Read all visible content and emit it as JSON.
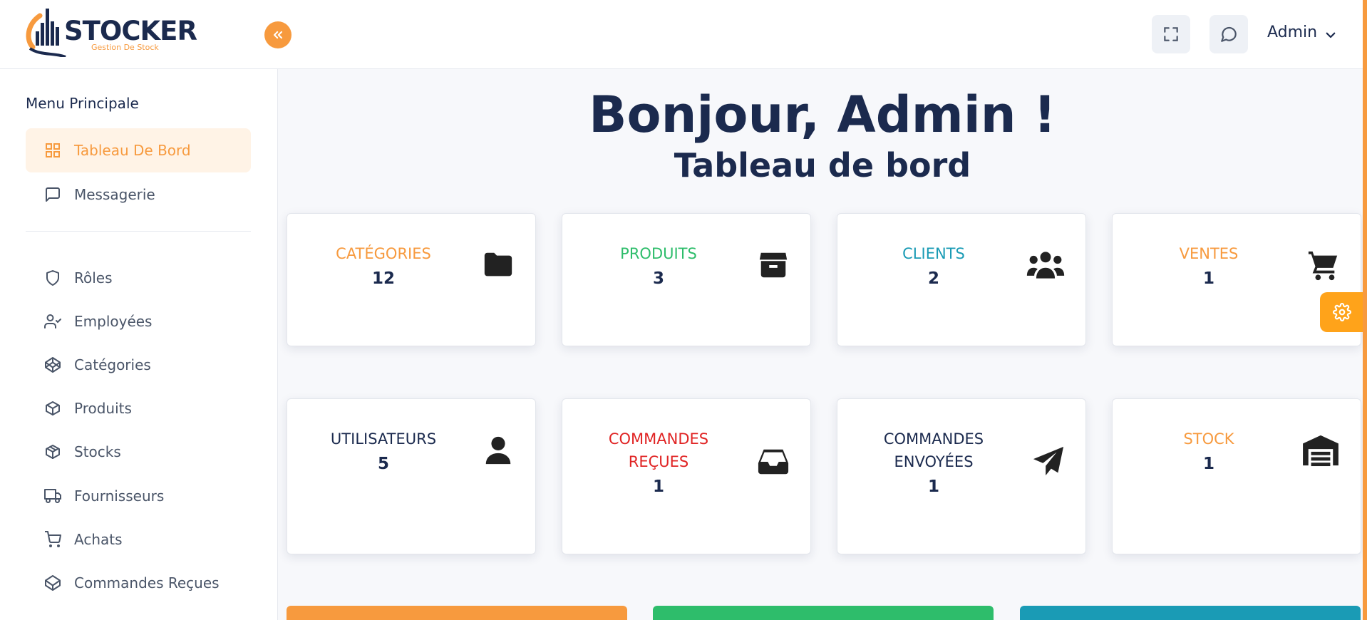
{
  "brand": {
    "name": "STOCKER",
    "tagline": "Gestion De Stock",
    "accent": "#f79a3e",
    "navy": "#1b2a4e"
  },
  "header": {
    "collapse_icon": "chevrons-left-icon",
    "fullscreen_icon": "fullscreen-icon",
    "messages_icon": "chat-bubble-icon",
    "user_name": "Admin",
    "user_caret_icon": "chevron-down-icon"
  },
  "sidebar": {
    "title": "Menu Principale",
    "items": [
      {
        "label": "Tableau De Bord",
        "icon": "grid-icon",
        "active": true
      },
      {
        "label": "Messagerie",
        "icon": "message-icon",
        "active": false
      },
      {
        "label": "Rôles",
        "icon": "shield-icon",
        "active": false
      },
      {
        "label": "Employées",
        "icon": "user-check-icon",
        "active": false
      },
      {
        "label": "Catégories",
        "icon": "codepen-icon",
        "active": false
      },
      {
        "label": "Produits",
        "icon": "box-icon",
        "active": false
      },
      {
        "label": "Stocks",
        "icon": "package-icon",
        "active": false
      },
      {
        "label": "Fournisseurs",
        "icon": "truck-icon",
        "active": false
      },
      {
        "label": "Achats",
        "icon": "shopping-cart-icon",
        "active": false
      },
      {
        "label": "Commandes Reçues",
        "icon": "inbox-box-icon",
        "active": false
      }
    ]
  },
  "main": {
    "greeting": "Bonjour, Admin !",
    "title": "Tableau de bord",
    "cards": [
      {
        "label": "CATÉGORIES",
        "value": "12",
        "color": "#f79a3e",
        "icon": "folder-icon"
      },
      {
        "label": "PRODUITS",
        "value": "3",
        "color": "#2ebd6b",
        "icon": "archive-box-icon"
      },
      {
        "label": "CLIENTS",
        "value": "2",
        "color": "#1a9bb5",
        "icon": "users-icon"
      },
      {
        "label": "VENTES",
        "value": "1",
        "color": "#f79a3e",
        "icon": "cart-icon"
      },
      {
        "label": "UTILISATEURS",
        "value": "5",
        "color": "#1b2a4e",
        "icon": "user-icon"
      },
      {
        "label_lines": [
          "COMMANDES",
          "REÇUES"
        ],
        "value": "1",
        "color": "#e02424",
        "icon": "inbox-icon"
      },
      {
        "label_lines": [
          "COMMANDES",
          "ENVOYÉES"
        ],
        "value": "1",
        "color": "#1b2a4e",
        "icon": "paper-plane-icon"
      },
      {
        "label": "STOCK",
        "value": "1",
        "color": "#f79a3e",
        "icon": "warehouse-icon"
      }
    ],
    "bottom_bars": [
      "#f79a3e",
      "#2ebd6b",
      "#1a9bb5"
    ]
  },
  "settings_fab": {
    "icon": "gear-icon",
    "color": "#ffa31a"
  }
}
